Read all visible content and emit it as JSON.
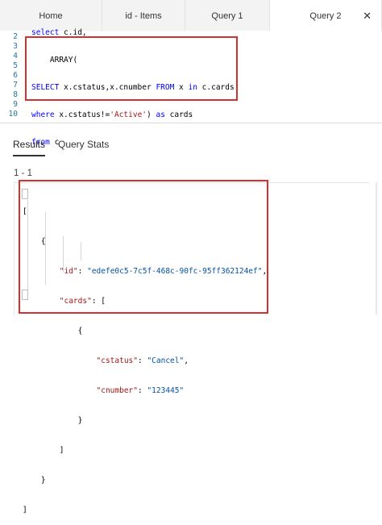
{
  "tabs": [
    {
      "label": "Home",
      "active": false
    },
    {
      "label": "id - Items",
      "active": false
    },
    {
      "label": "Query 1",
      "active": false
    },
    {
      "label": "Query 2",
      "active": true
    }
  ],
  "close_glyph": "✕",
  "editor": {
    "line_numbers": [
      "2",
      "3",
      "4",
      "5",
      "6",
      "7",
      "8",
      "9",
      "10"
    ]
  },
  "results_tabs": {
    "results": "Results",
    "query_stats": "Query Stats"
  },
  "result_count": "1 - 1",
  "json_result": {
    "id_key": "\"id\"",
    "id_value": "\"edefe0c5-7c5f-468c-90fc-95ff362124ef\"",
    "cards_key": "\"cards\"",
    "cstatus_key": "\"cstatus\"",
    "cstatus_value": "\"Cancel\"",
    "cnumber_key": "\"cnumber\"",
    "cnumber_value": "\"123445\""
  },
  "colors": {
    "highlight_border": "#d33030",
    "keyword": "#0000ff",
    "string": "#a31515",
    "json_value": "#0451a5"
  }
}
